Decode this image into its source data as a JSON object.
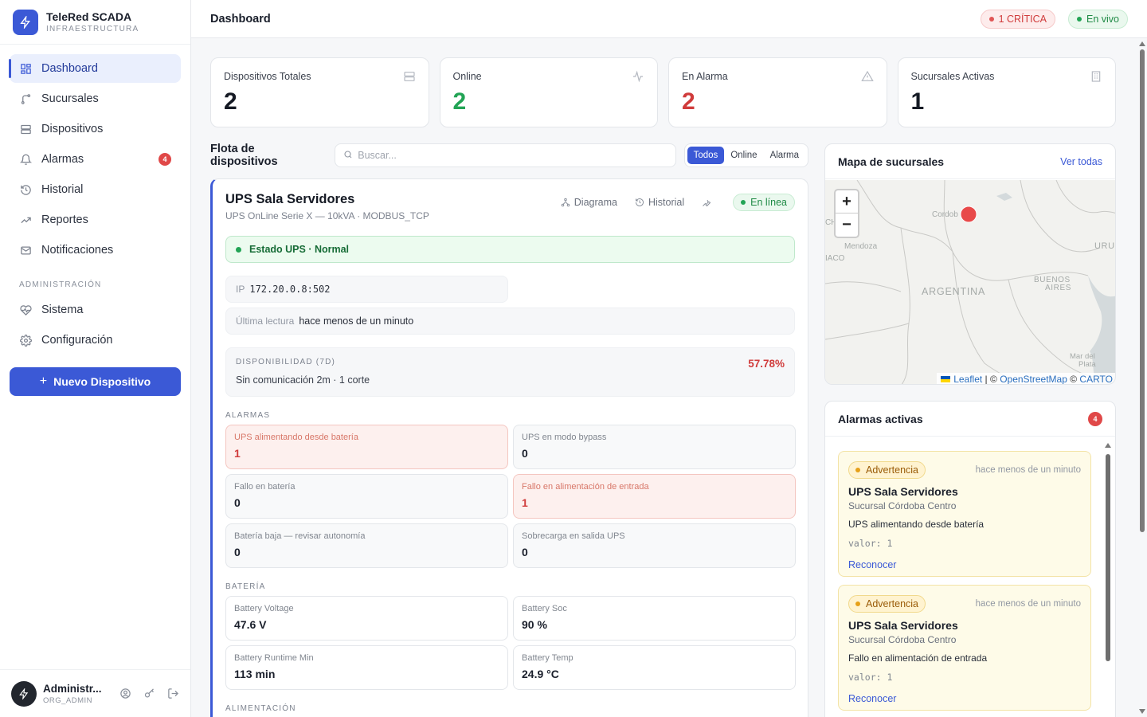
{
  "brand": {
    "title": "TeleRed SCADA",
    "subtitle": "INFRAESTRUCTURA",
    "logo_icon": "bolt-icon"
  },
  "sidebar": {
    "items": [
      {
        "label": "Dashboard",
        "icon": "dashboard-icon",
        "active": true
      },
      {
        "label": "Sucursales",
        "icon": "branch-icon"
      },
      {
        "label": "Dispositivos",
        "icon": "server-icon"
      },
      {
        "label": "Alarmas",
        "icon": "bell-icon",
        "badge": "4"
      },
      {
        "label": "Historial",
        "icon": "history-icon"
      },
      {
        "label": "Reportes",
        "icon": "trend-icon"
      },
      {
        "label": "Notificaciones",
        "icon": "mail-icon"
      }
    ],
    "admin_section": "ADMINISTRACIÓN",
    "admin_items": [
      {
        "label": "Sistema",
        "icon": "heart-pulse-icon"
      },
      {
        "label": "Configuración",
        "icon": "gear-icon"
      }
    ],
    "new_device_label": "Nuevo Dispositivo"
  },
  "user": {
    "name": "Administr...",
    "role": "ORG_ADMIN"
  },
  "header": {
    "title": "Dashboard",
    "critical": "1 CRÍTICA",
    "live": "En vivo"
  },
  "stats": [
    {
      "label": "Dispositivos Totales",
      "value": "2",
      "color": "#151a24",
      "icon": "server-icon"
    },
    {
      "label": "Online",
      "value": "2",
      "color": "#22a455",
      "icon": "activity-icon"
    },
    {
      "label": "En Alarma",
      "value": "2",
      "color": "#d03b3b",
      "icon": "warning-icon"
    },
    {
      "label": "Sucursales Activas",
      "value": "1",
      "color": "#151a24",
      "icon": "building-icon"
    }
  ],
  "fleet": {
    "title": "Flota de dispositivos",
    "search_placeholder": "Buscar...",
    "filters": [
      "Todos",
      "Online",
      "Alarma"
    ]
  },
  "device": {
    "name": "UPS Sala Servidores",
    "subtitle": "UPS OnLine Serie X — 10kVA · MODBUS_TCP",
    "actions": {
      "diagram": "Diagrama",
      "history": "Historial"
    },
    "online": "En línea",
    "ups_status": "Estado UPS · Normal",
    "ip_label": "IP",
    "ip": "172.20.0.8:502",
    "last_read_label": "Última lectura",
    "last_read": "hace menos de un minuto",
    "availability_label": "DISPONIBILIDAD (7D)",
    "availability_pct": "57.78%",
    "availability_desc": "Sin comunicación 2m · 1 corte",
    "alarms_label": "ALARMAS",
    "alarms": [
      {
        "label": "UPS alimentando desde batería",
        "value": "1",
        "active": true
      },
      {
        "label": "UPS en modo bypass",
        "value": "0",
        "active": false
      },
      {
        "label": "Fallo en batería",
        "value": "0",
        "active": false
      },
      {
        "label": "Fallo en alimentación de entrada",
        "value": "1",
        "active": true
      },
      {
        "label": "Batería baja — revisar autonomía",
        "value": "0",
        "active": false
      },
      {
        "label": "Sobrecarga en salida UPS",
        "value": "0",
        "active": false
      }
    ],
    "battery_label": "BATERÍA",
    "battery": [
      {
        "label": "Battery Voltage",
        "value": "47.6 V"
      },
      {
        "label": "Battery Soc",
        "value": "90 %"
      },
      {
        "label": "Battery Runtime Min",
        "value": "113 min"
      },
      {
        "label": "Battery Temp",
        "value": "24.9 °C"
      }
    ],
    "power_label": "ALIMENTACIÓN"
  },
  "map": {
    "title": "Mapa de sucursales",
    "view_all": "Ver todas",
    "zoom_in": "+",
    "zoom_out": "−",
    "labels": {
      "cordoba": "Cordob",
      "mendoza": "Mendoza",
      "argentina": "ARGENTINA",
      "buenos_aires_1": "BUENOS",
      "buenos_aires_2": "AIRES",
      "uru": "URU",
      "taco": "IACO",
      "mar_del": "Mar del",
      "plata": "Plata",
      "ch": "CH"
    },
    "attribution": {
      "leaflet": "Leaflet",
      "sep1": " | © ",
      "osm": "OpenStreetMap",
      "sep2": " © ",
      "carto": "CARTO"
    }
  },
  "active_alarms": {
    "title": "Alarmas activas",
    "count": "4",
    "items": [
      {
        "level": "Advertencia",
        "time": "hace menos de un minuto",
        "device": "UPS Sala Servidores",
        "branch": "Sucursal Córdoba Centro",
        "message": "UPS alimentando desde batería",
        "value": "valor: 1",
        "ack": "Reconocer"
      },
      {
        "level": "Advertencia",
        "time": "hace menos de un minuto",
        "device": "UPS Sala Servidores",
        "branch": "Sucursal Córdoba Centro",
        "message": "Fallo en alimentación de entrada",
        "value": "valor: 1",
        "ack": "Reconocer"
      }
    ]
  }
}
